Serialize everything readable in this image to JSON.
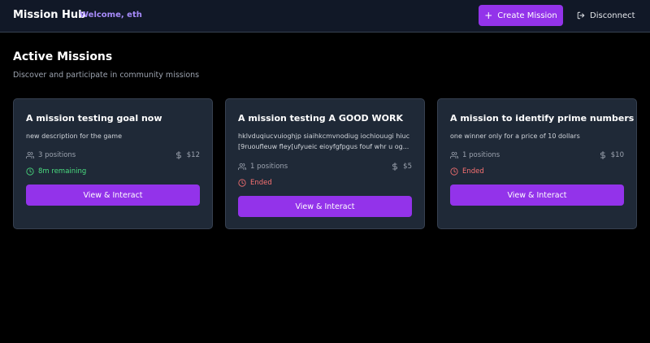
{
  "header": {
    "brand": "Mission Hub",
    "welcome": "Welcome, eth",
    "create_label": "Create Mission",
    "disconnect_label": "Disconnect"
  },
  "section": {
    "title": "Active Missions",
    "subtitle": "Discover and participate in community missions"
  },
  "missions": [
    {
      "title": "A mission testing goal now",
      "description": "new description for the game",
      "positions": "3 positions",
      "price": "$12",
      "status": "8m remaining",
      "button": "View & Interact"
    },
    {
      "title": "A mission testing A GOOD WORK",
      "description": "hklvduqiucvuioghjp siaihkcmvnodiug iochiouugi hiuc [9ruoufleuw fley[ufyueic eioyfgfpgus fouf whr u og...",
      "positions": "1 positions",
      "price": "$5",
      "status": "Ended",
      "button": "View & Interact"
    },
    {
      "title": "A mission to identify prime numbers",
      "description": "one winner only for a price of 10 dollars",
      "positions": "1 positions",
      "price": "$10",
      "status": "Ended",
      "button": "View & Interact"
    }
  ],
  "colors": {
    "accent": "#9333ea",
    "welcome": "#a78bfa",
    "remaining": "#4ade80",
    "ended": "#f87171"
  },
  "icons": [
    "plus-icon",
    "logout-icon",
    "users-icon",
    "dollar-icon",
    "clock-icon"
  ]
}
